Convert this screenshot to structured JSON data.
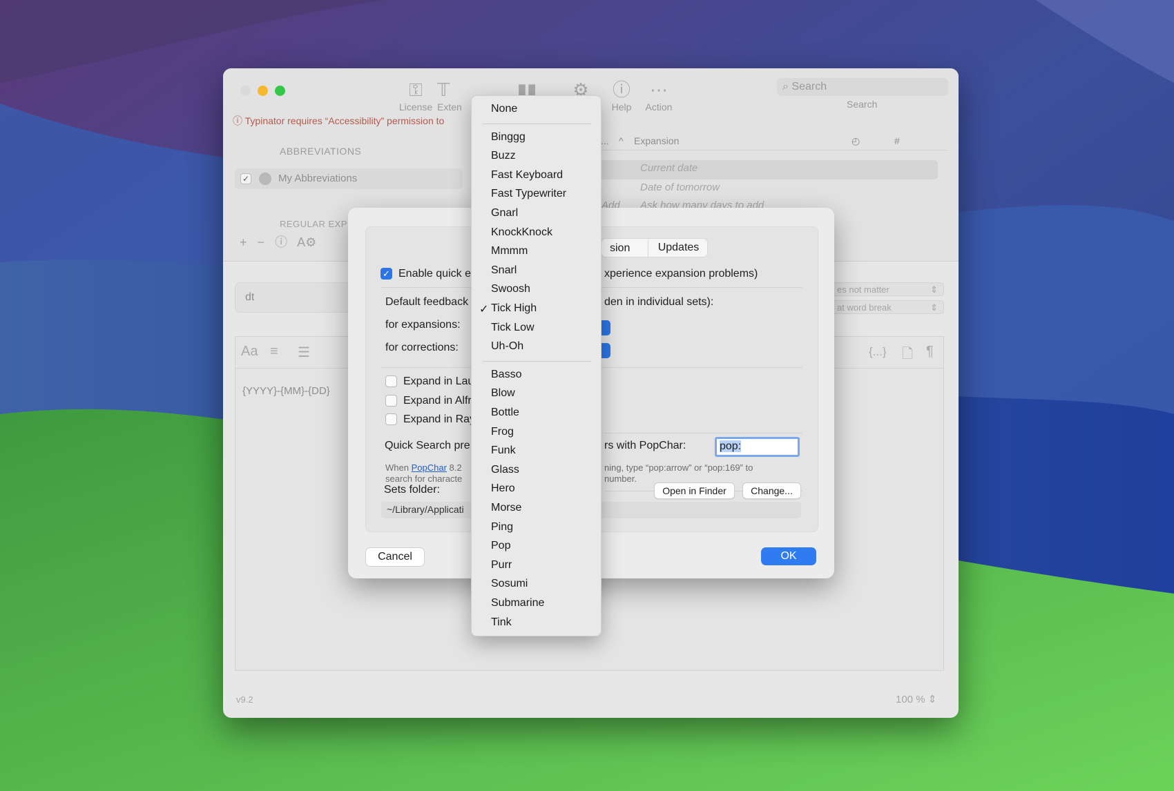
{
  "window": {
    "toolbar": [
      {
        "label": "License",
        "icon": "key-icon"
      },
      {
        "label": "Exten",
        "icon": "extension-icon"
      },
      {
        "label": "",
        "icon": "statistics-icon"
      },
      {
        "label": "",
        "icon": "gear-icon"
      },
      {
        "label": "Help",
        "icon": "help-icon"
      },
      {
        "label": "Action",
        "icon": "action-icon"
      }
    ],
    "search_placeholder": "Search",
    "search_caption": "Search",
    "warning": "Typinator requires “Accessibility” permission to",
    "sidebar": {
      "title": "ABBREVIATIONS",
      "item": "My Abbreviations",
      "title2": "REGULAR EXP",
      "tools": [
        "+",
        "−",
        "ⓘ",
        "A⚙"
      ]
    },
    "table": {
      "col_partial": "...",
      "col_expansion": "Expansion",
      "col_clock": "◴",
      "col_hash": "#",
      "rows": [
        "Current date",
        "Date of tomorrow",
        "Ask how many days to add"
      ],
      "row3_prefix": "Add"
    },
    "abbreviation_value": "dt",
    "popup1": "es not matter",
    "popup2": "at word break",
    "editor_tools": [
      "Aa",
      "≡",
      "☰"
    ],
    "editor_tools_right": [
      "{...}",
      "🗋",
      "¶"
    ],
    "editor_body": "{YYYY}-{MM}-{DD}",
    "version": "v9.2",
    "zoom": "100 %"
  },
  "prefs": {
    "tab_partial": "sion",
    "tab_updates": "Updates",
    "enable_quick_a": "Enable quick e",
    "enable_quick_b": "xperience expansion problems)",
    "default_feedback_a": "Default feedback",
    "default_feedback_b": "den in individual sets):",
    "for_expansions": "for expansions:",
    "for_corrections": "for corrections:",
    "expand_launch": "Expand in Lau",
    "expand_alfred": "Expand in Alfr",
    "expand_raycast": "Expand in Ray",
    "quick_search_a": "Quick Search pre",
    "quick_search_b": "rs with PopChar:",
    "popchar_value": "pop:",
    "hint_when": "When",
    "hint_link": "PopChar",
    "hint_a": "8.2",
    "hint_b": "ning, type “pop:arrow” or “pop:169” to",
    "hint_c": "search for characte",
    "hint_d": "number.",
    "sets_folder": "Sets folder:",
    "open_finder": "Open in Finder",
    "change": "Change...",
    "path": "~/Library/Applicati",
    "cancel": "Cancel",
    "ok": "OK"
  },
  "menu": {
    "groups": [
      [
        "None"
      ],
      [
        "Binggg",
        "Buzz",
        "Fast Keyboard",
        "Fast Typewriter",
        "Gnarl",
        "KnockKnock",
        "Mmmm",
        "Snarl",
        "Swoosh",
        "Tick High",
        "Tick Low",
        "Uh-Oh"
      ],
      [
        "Basso",
        "Blow",
        "Bottle",
        "Frog",
        "Funk",
        "Glass",
        "Hero",
        "Morse",
        "Ping",
        "Pop",
        "Purr",
        "Sosumi",
        "Submarine",
        "Tink"
      ]
    ],
    "selected": "Tick High",
    "check_mark": "✓"
  },
  "colors": {
    "accent": "#2c75e6",
    "close": "#d9d9d9",
    "minimize": "#f5b82e",
    "zoom": "#34c748"
  }
}
